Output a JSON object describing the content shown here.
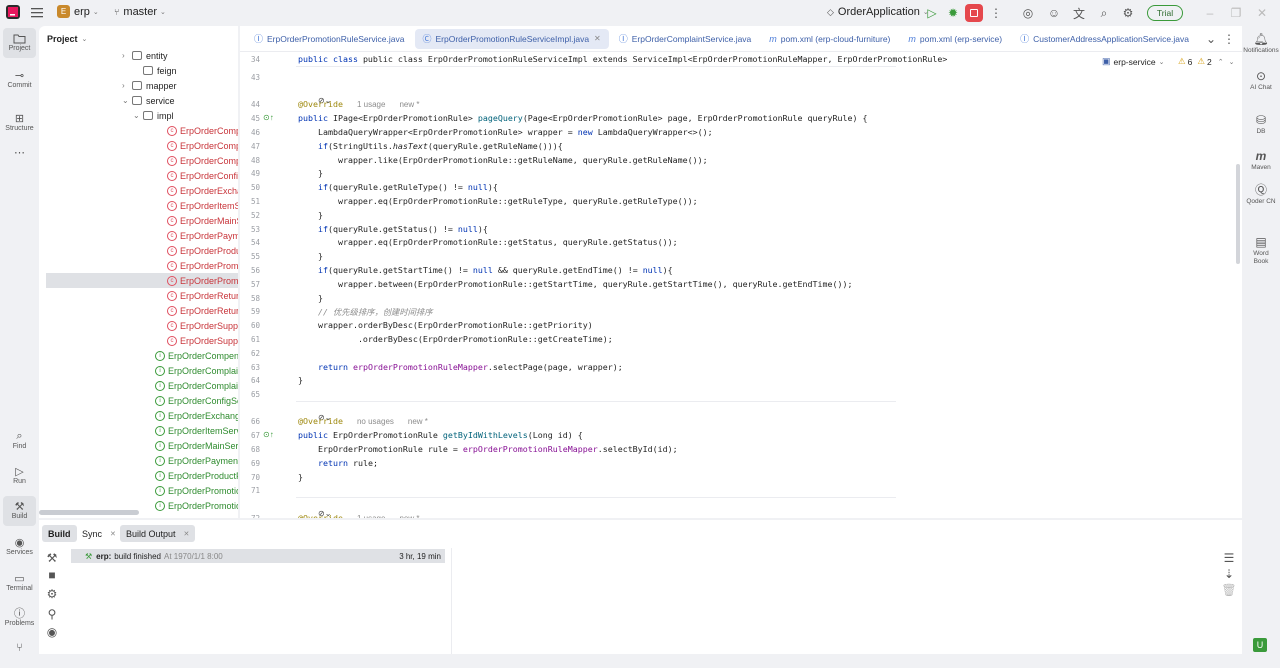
{
  "titlebar": {
    "project_badge": "E",
    "project_name": "erp",
    "branch": "master",
    "run_config": "OrderApplication",
    "trial_label": "Trial"
  },
  "left_tools": [
    {
      "label": "Project",
      "icon": "folder-icon"
    },
    {
      "label": "Commit",
      "icon": "commit-icon"
    },
    {
      "label": "Structure",
      "icon": "structure-icon"
    },
    {
      "label": "",
      "icon": "more-icon"
    },
    {
      "label": "Find",
      "icon": "search-icon"
    },
    {
      "label": "Run",
      "icon": "run-icon"
    },
    {
      "label": "Build",
      "icon": "hammer-icon"
    },
    {
      "label": "Services",
      "icon": "services-icon"
    },
    {
      "label": "Terminal",
      "icon": "terminal-icon"
    },
    {
      "label": "Problems",
      "icon": "problems-icon"
    },
    {
      "label": "",
      "icon": "git-icon"
    }
  ],
  "right_tools": [
    {
      "label": "Notifications",
      "icon": "bell-icon"
    },
    {
      "label": "AI Chat",
      "icon": "ai-chat-icon"
    },
    {
      "label": "DB",
      "icon": "database-icon"
    },
    {
      "label": "Maven",
      "icon": "maven-icon"
    },
    {
      "label": "Qoder CN",
      "icon": "qoder-icon"
    },
    {
      "label": "Word Book",
      "icon": "wordbook-icon"
    }
  ],
  "project_panel": {
    "title": "Project",
    "tree": [
      {
        "label": "entity",
        "kind": "package"
      },
      {
        "label": "feign",
        "kind": "package"
      },
      {
        "label": "mapper",
        "kind": "package"
      },
      {
        "label": "service",
        "kind": "package"
      },
      {
        "label": "impl",
        "kind": "package"
      },
      {
        "label": "ErpOrderCompe",
        "kind": "class"
      },
      {
        "label": "ErpOrderCompl",
        "kind": "class"
      },
      {
        "label": "ErpOrderCompl",
        "kind": "class"
      },
      {
        "label": "ErpOrderConfig",
        "kind": "class"
      },
      {
        "label": "ErpOrderExchan",
        "kind": "class"
      },
      {
        "label": "ErpOrderItemSe",
        "kind": "class"
      },
      {
        "label": "ErpOrderMainS",
        "kind": "class"
      },
      {
        "label": "ErpOrderPaym",
        "kind": "class"
      },
      {
        "label": "ErpOrderProduc",
        "kind": "class"
      },
      {
        "label": "ErpOrderPromo",
        "kind": "class"
      },
      {
        "label": "ErpOrderPromo",
        "kind": "class"
      },
      {
        "label": "ErpOrderReturn",
        "kind": "class"
      },
      {
        "label": "ErpOrderReturn",
        "kind": "class"
      },
      {
        "label": "ErpOrderSupplie",
        "kind": "class"
      },
      {
        "label": "ErpOrderSupplie",
        "kind": "class"
      },
      {
        "label": "ErpOrderCompens",
        "kind": "interface"
      },
      {
        "label": "ErpOrderComplaint",
        "kind": "interface"
      },
      {
        "label": "ErpOrderComplaint",
        "kind": "interface"
      },
      {
        "label": "ErpOrderConfigSer",
        "kind": "interface"
      },
      {
        "label": "ErpOrderExchangeS",
        "kind": "interface"
      },
      {
        "label": "ErpOrderItemServic",
        "kind": "interface"
      },
      {
        "label": "ErpOrderMainServi",
        "kind": "interface"
      },
      {
        "label": "ErpOrderPaymentS",
        "kind": "interface"
      },
      {
        "label": "ErpOrderProductPr",
        "kind": "interface"
      },
      {
        "label": "ErpOrderPromotion",
        "kind": "interface"
      },
      {
        "label": "ErpOrderPromotion",
        "kind": "interface"
      }
    ]
  },
  "editor": {
    "tabs": [
      {
        "label": "ErpOrderPromotionRuleService.java",
        "icon": "interface-icon"
      },
      {
        "label": "ErpOrderPromotionRuleServiceImpl.java",
        "icon": "class-icon",
        "active": true
      },
      {
        "label": "ErpOrderComplaintService.java",
        "icon": "interface-icon"
      },
      {
        "label": "pom.xml (erp-cloud-furniture)",
        "icon": "maven-icon"
      },
      {
        "label": "pom.xml (erp-service)",
        "icon": "maven-icon"
      },
      {
        "label": "CustomerAddressApplicationService.java",
        "icon": "interface-icon"
      }
    ],
    "module_label": "erp-service",
    "warnings": "6",
    "weak_warnings": "2",
    "sticky_line": "public class ErpOrderPromotionRuleServiceImpl extends ServiceImpl<ErpOrderPromotionRuleMapper, ErpOrderPromotionRule>",
    "lines": [
      {
        "n": "34",
        "t": ""
      },
      {
        "n": "43",
        "t": ""
      },
      {
        "n": "44",
        "t": "@Override"
      },
      {
        "n": "45",
        "t": "public IPage<ErpOrderPromotionRule> pageQuery(Page<ErpOrderPromotionRule> page, ErpOrderPromotionRule queryRule) {"
      },
      {
        "n": "46",
        "t": "    LambdaQueryWrapper<ErpOrderPromotionRule> wrapper = new LambdaQueryWrapper<>();"
      },
      {
        "n": "47",
        "t": "    if(StringUtils.hasText(queryRule.getRuleName())){"
      },
      {
        "n": "48",
        "t": "        wrapper.like(ErpOrderPromotionRule::getRuleName, queryRule.getRuleName());"
      },
      {
        "n": "49",
        "t": "    }"
      },
      {
        "n": "50",
        "t": "    if(queryRule.getRuleType() != null){"
      },
      {
        "n": "51",
        "t": "        wrapper.eq(ErpOrderPromotionRule::getRuleType, queryRule.getRuleType());"
      },
      {
        "n": "52",
        "t": "    }"
      },
      {
        "n": "53",
        "t": "    if(queryRule.getStatus() != null){"
      },
      {
        "n": "54",
        "t": "        wrapper.eq(ErpOrderPromotionRule::getStatus, queryRule.getStatus());"
      },
      {
        "n": "55",
        "t": "    }"
      },
      {
        "n": "56",
        "t": "    if(queryRule.getStartTime() != null && queryRule.getEndTime() != null){"
      },
      {
        "n": "57",
        "t": "        wrapper.between(ErpOrderPromotionRule::getStartTime, queryRule.getStartTime(), queryRule.getEndTime());"
      },
      {
        "n": "58",
        "t": "    }"
      },
      {
        "n": "59",
        "t": "    // 优先级排序，创建时间排序"
      },
      {
        "n": "60",
        "t": "    wrapper.orderByDesc(ErpOrderPromotionRule::getPriority)"
      },
      {
        "n": "61",
        "t": "            .orderByDesc(ErpOrderPromotionRule::getCreateTime);"
      },
      {
        "n": "62",
        "t": ""
      },
      {
        "n": "63",
        "t": "    return erpOrderPromotionRuleMapper.selectPage(page, wrapper);"
      },
      {
        "n": "64",
        "t": "}"
      },
      {
        "n": "65",
        "t": ""
      },
      {
        "n": "66",
        "t": "@Override"
      },
      {
        "n": "67",
        "t": "public ErpOrderPromotionRule getByIdWithLevels(Long id) {"
      },
      {
        "n": "68",
        "t": "    ErpOrderPromotionRule rule = erpOrderPromotionRuleMapper.selectById(id);"
      },
      {
        "n": "69",
        "t": "    return rule;"
      },
      {
        "n": "70",
        "t": "}"
      },
      {
        "n": "71",
        "t": ""
      },
      {
        "n": "72",
        "t": "@Override"
      }
    ],
    "usage_hints": [
      {
        "usages": "1 usage",
        "new": "new *"
      },
      {
        "usages": "no usages",
        "new": "new *"
      },
      {
        "usages": "1 usage",
        "new": "new *"
      }
    ]
  },
  "bottom_panel": {
    "tabs": [
      {
        "label": "Build"
      },
      {
        "label": "Sync"
      },
      {
        "label": "Build Output"
      }
    ],
    "build_label": "erp:",
    "build_status": "build finished",
    "build_time": "At 1970/1/1 8:00",
    "build_duration": "3 hr, 19 min"
  }
}
